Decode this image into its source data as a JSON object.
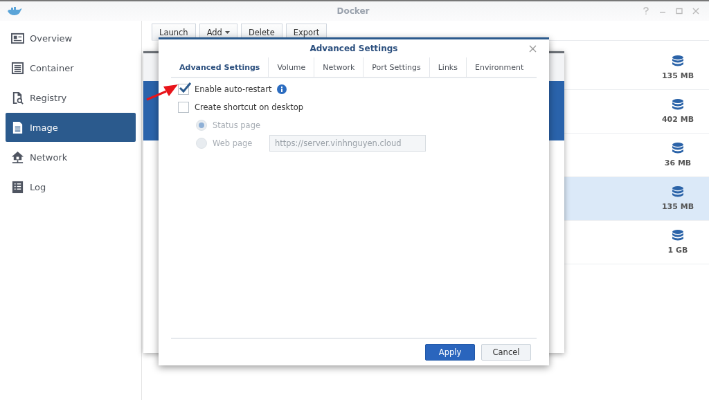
{
  "window": {
    "title": "Docker"
  },
  "sidebar": {
    "items": [
      {
        "label": "Overview",
        "selected": false
      },
      {
        "label": "Container",
        "selected": false
      },
      {
        "label": "Registry",
        "selected": false
      },
      {
        "label": "Image",
        "selected": true
      },
      {
        "label": "Network",
        "selected": false
      },
      {
        "label": "Log",
        "selected": false
      }
    ]
  },
  "toolbar": [
    {
      "label": "Launch",
      "dropdown": false
    },
    {
      "label": "Add",
      "dropdown": true
    },
    {
      "label": "Delete",
      "dropdown": false
    },
    {
      "label": "Export",
      "dropdown": false
    }
  ],
  "images": [
    {
      "size": "135 MB",
      "selected": false
    },
    {
      "size": "402 MB",
      "selected": false
    },
    {
      "size": "36 MB",
      "selected": false
    },
    {
      "size": "135 MB",
      "selected": true
    },
    {
      "size": "1 GB",
      "selected": false
    }
  ],
  "dialog": {
    "title": "Advanced Settings",
    "tabs": [
      {
        "label": "Advanced Settings",
        "selected": true
      },
      {
        "label": "Volume",
        "selected": false
      },
      {
        "label": "Network",
        "selected": false
      },
      {
        "label": "Port Settings",
        "selected": false
      },
      {
        "label": "Links",
        "selected": false
      },
      {
        "label": "Environment",
        "selected": false
      }
    ],
    "options": [
      {
        "label": "Enable auto-restart",
        "checked": true,
        "info": true
      },
      {
        "label": "Create shortcut on desktop",
        "checked": false,
        "info": false
      }
    ],
    "shortcut_targets": [
      {
        "label": "Status page",
        "selected": true,
        "disabled": true
      },
      {
        "label": "Web page",
        "selected": false,
        "disabled": true,
        "value": "https://server.vinhnguyen.cloud"
      }
    ],
    "buttons": [
      {
        "label": "Apply",
        "kind": "primary"
      },
      {
        "label": "Cancel",
        "kind": "secondary"
      }
    ]
  }
}
